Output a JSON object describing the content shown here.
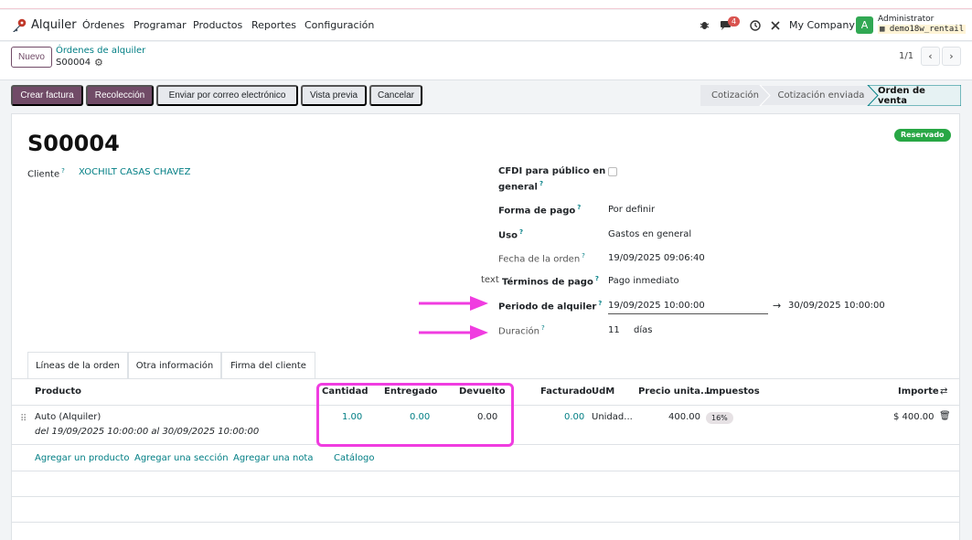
{
  "navbar": {
    "app_name": "Alquiler",
    "menu": [
      "Órdenes",
      "Programar",
      "Productos",
      "Reportes",
      "Configuración"
    ],
    "messages_count": "4",
    "company": "My Company",
    "avatar_letter": "A",
    "user": "Administrator",
    "database": "demo18w_rentail"
  },
  "control": {
    "new_button": "Nuevo",
    "breadcrumb": "Órdenes de alquiler",
    "record": "S00004",
    "pager": "1/1"
  },
  "actions": {
    "buttons": [
      "Crear factura",
      "Recolección",
      "Enviar por correo electrónico",
      "Vista previa",
      "Cancelar"
    ],
    "statuses": [
      "Cotización",
      "Cotización enviada",
      "Orden de venta"
    ]
  },
  "form": {
    "title": "S00004",
    "reserved_badge": "Reservado",
    "customer_label": "Cliente",
    "customer_value": "XOCHILT CASAS CHAVEZ",
    "cfdi_label_1": "CFDI para público en",
    "cfdi_label_2": "general",
    "payment_method_label": "Forma de pago",
    "payment_method_value": "Por definir",
    "usage_label": "Uso",
    "usage_value": "Gastos en general",
    "order_date_label": "Fecha de la orden",
    "order_date_value": "19/09/2025 09:06:40",
    "payment_terms_prefix": "text",
    "payment_terms_label": "Términos de pago",
    "payment_terms_value": "Pago inmediato",
    "rental_period_label": "Periodo de alquiler",
    "rental_start": "19/09/2025 10:00:00",
    "rental_end": "30/09/2025 10:00:00",
    "duration_label": "Duración",
    "duration_value": "11",
    "duration_unit": "días"
  },
  "tabs": [
    "Líneas de la orden",
    "Otra información",
    "Firma del cliente"
  ],
  "table": {
    "headers": [
      "Producto",
      "Cantidad",
      "Entregado",
      "Devuelto",
      "Facturado",
      "UdM",
      "Precio unita...",
      "Impuestos",
      "Importe"
    ],
    "row": {
      "product": "Auto (Alquiler)",
      "product_detail": "del 19/09/2025 10:00:00 al 30/09/2025 10:00:00",
      "quantity": "1.00",
      "delivered": "0.00",
      "returned": "0.00",
      "invoiced": "0.00",
      "uom": "Unidad...",
      "unit_price": "400.00",
      "tax": "16%",
      "amount": "$ 400.00"
    },
    "add_links": [
      "Agregar un producto",
      "Agregar una sección",
      "Agregar una nota",
      "Catálogo"
    ]
  },
  "colors": {
    "primary": "#714b67",
    "link": "#017e84",
    "annotation": "#f03ce0",
    "reserved": "#28a745"
  }
}
